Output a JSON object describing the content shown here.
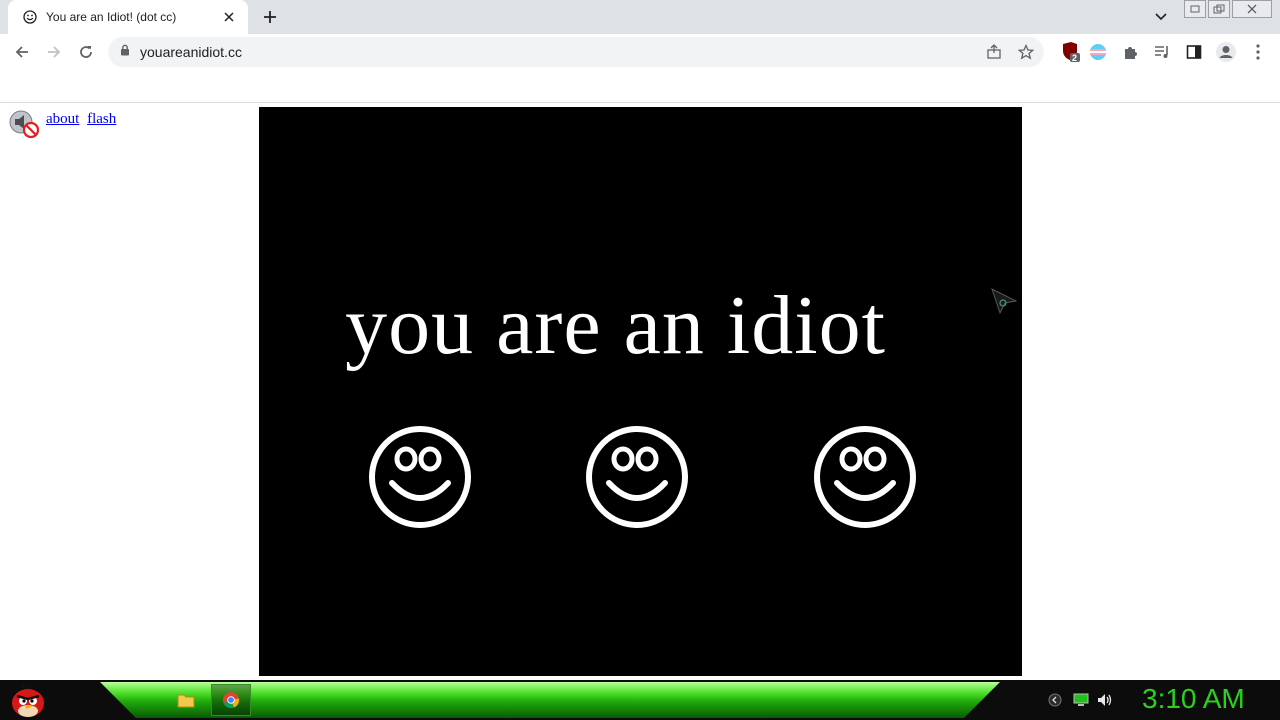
{
  "browser": {
    "tab": {
      "title": "You are an Idiot! (dot cc)"
    },
    "address_bar": {
      "url": "youareanidiot.cc"
    },
    "extension_badge": "2"
  },
  "page": {
    "links": [
      "about",
      "flash"
    ],
    "headline": "you are an idiot",
    "smiley_count": 3,
    "background_color": "#000000",
    "text_color": "#ffffff",
    "link_color": "#0000ee"
  },
  "taskbar": {
    "clock": "3:10 AM",
    "accent_color": "#2bd11c"
  },
  "icons": {
    "tab_favicon": "smiley-icon",
    "start": "angry-bird-icon",
    "apps": [
      "file-explorer-icon",
      "chrome-icon"
    ]
  }
}
